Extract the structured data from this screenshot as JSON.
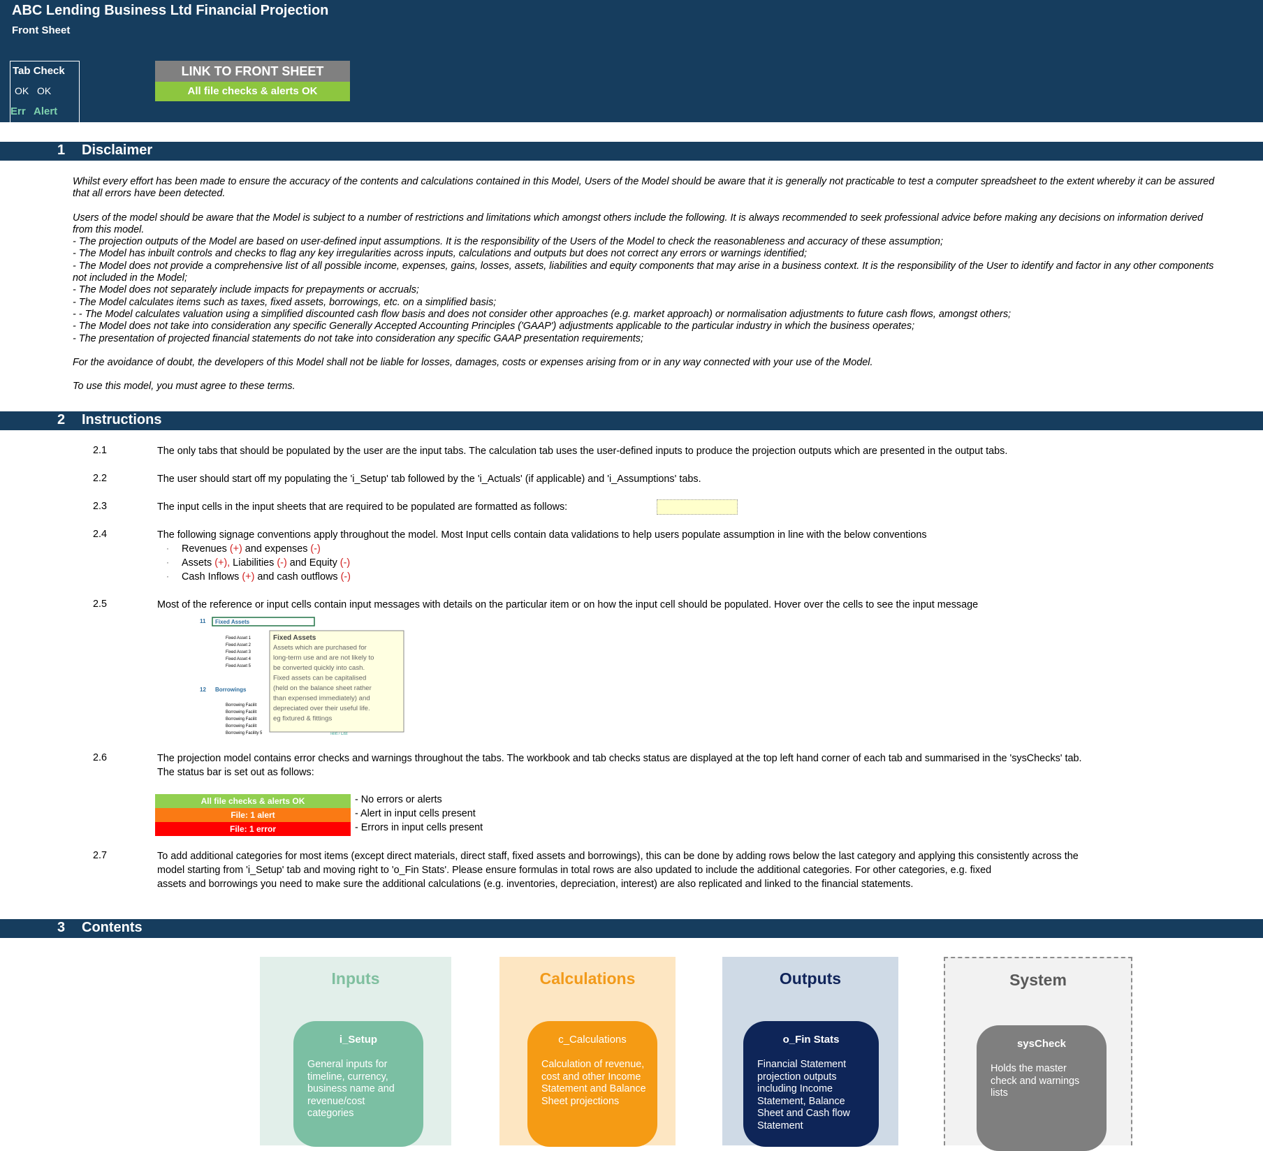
{
  "header": {
    "title": "ABC Lending Business Ltd Financial Projection",
    "sheet": "Front Sheet",
    "tab_check": {
      "title": "Tab Check",
      "ok1": "OK",
      "ok2": "OK",
      "err": "Err",
      "alert": "Alert"
    },
    "link_button": "LINK TO FRONT SHEET",
    "status": "All file checks & alerts OK"
  },
  "sections": {
    "disclaimer": {
      "num": "1",
      "title": "Disclaimer"
    },
    "instructions": {
      "num": "2",
      "title": "Instructions"
    },
    "contents": {
      "num": "3",
      "title": "Contents"
    }
  },
  "disclaimer": {
    "p1": "Whilst every effort has been made to ensure the accuracy of the contents and calculations contained in this Model, Users of the Model should be aware that it is generally not practicable to test a computer spreadsheet to the extent whereby it can be assured that all errors have been detected.",
    "p2": "Users of the model should be aware that the Model is subject to a number of restrictions and limitations which amongst others include the following. It is always recommended to seek professional advice before making any decisions on information derived from this model.",
    "items": [
      "- The projection outputs of the Model are based on user-defined input assumptions. It is the responsibility of the Users of the Model to check the reasonableness and accuracy of these assumption;",
      "- The Model has inbuilt controls and checks to flag any key irregularities across inputs, calculations and outputs but does not correct any errors or warnings identified;",
      "- The Model does not provide a comprehensive list of all possible income, expenses, gains, losses, assets, liabilities and equity components that may arise in a business context. It is the responsibility of the User to identify and factor in any other components not included in the Model;",
      "- The Model does not separately include impacts for prepayments or accruals;",
      "- The Model calculates items such as taxes, fixed assets, borrowings, etc. on a simplified basis;",
      "- - The Model calculates valuation using a simplified discounted cash flow basis and does not consider other approaches (e.g. market approach) or normalisation adjustments to future cash flows, amongst others;",
      "- The Model does not take into consideration any specific Generally Accepted Accounting Principles ('GAAP') adjustments applicable to the particular industry in which the business operates;",
      "- The presentation of projected financial statements do not take into consideration any specific GAAP presentation requirements;"
    ],
    "p3": "For the avoidance of doubt, the developers of this Model shall not be liable for losses, damages, costs or expenses arising from or in any way connected with your use of the Model.",
    "p4": "To use this model, you must agree to these terms."
  },
  "instructions": {
    "i1": {
      "num": "2.1",
      "text": "The only tabs that should be populated by the user are the input tabs. The calculation tab uses the user-defined inputs to produce the projection outputs which are presented in the output tabs."
    },
    "i2": {
      "num": "2.2",
      "text": "The user should start off my populating the 'i_Setup' tab followed by the 'i_Actuals' (if applicable) and 'i_Assumptions' tabs."
    },
    "i3": {
      "num": "2.3",
      "text": "The input cells in the input sheets that are required to be populated are formatted as follows:"
    },
    "i4": {
      "num": "2.4",
      "text": "The following signage conventions apply throughout the model. Most Input cells contain data validations to help users populate assumption in line with the below conventions",
      "b1": {
        "a": "Revenues ",
        "s1": "(+)",
        "b": " and expenses ",
        "s2": "(-)"
      },
      "b2": {
        "a": "Assets ",
        "s1": "(+),",
        "b": " Liabilities ",
        "s2": "(-)",
        "c": " and Equity ",
        "s3": "(-)"
      },
      "b3": {
        "a": "Cash Inflows ",
        "s1": "(+)",
        "b": " and cash outflows ",
        "s2": "(-)"
      }
    },
    "i5": {
      "num": "2.5",
      "text": "Most of the reference or input cells contain input messages with details on the particular item or on how the input cell should be populated. Hover over the cells to see the input message",
      "tooltip": {
        "row11": "11",
        "fixed_assets": "Fixed Assets",
        "assets": [
          "Fixed Asset 1",
          "Fixed Asset 2",
          "Fixed Asset 3",
          "Fixed Asset 4",
          "Fixed Asset 5"
        ],
        "row12": "12",
        "borrowings": "Borrowings",
        "facilities": [
          "Borrowing Facilit",
          "Borrowing Facilit",
          "Borrowing Facilit",
          "Borrowing Facilit",
          "Borrowing Facilit"
        ],
        "facility_last": "Borrowing Facility 5",
        "text_list": "Text / List",
        "box_title": "Fixed Assets",
        "box_text": "Assets which are purchased for long-term use and are not likely to be converted quickly into cash. Fixed assets can be capitalised (held on the balance sheet rather than expensed immediately) and depreciated over their useful life. eg fixtured & fittings"
      }
    },
    "i6": {
      "num": "2.6",
      "text1": "The projection model contains error checks and warnings throughout the tabs. The workbook and tab checks status are displayed at the top left hand corner of each tab and summarised in the 'sysChecks' tab.",
      "text2": "The status bar is set out as follows:",
      "legend": [
        {
          "bar": "All file checks & alerts OK",
          "desc": "- No errors or alerts",
          "color": "#92d050"
        },
        {
          "bar": "File: 1 alert",
          "desc": "- Alert in input cells present",
          "color": "#fa7a14"
        },
        {
          "bar": "File: 1 error",
          "desc": "- Errors in input cells present",
          "color": "#ff0000"
        }
      ]
    },
    "i7": {
      "num": "2.7",
      "l1": "To add additional categories for most items (except direct materials, direct staff, fixed assets and borrowings), this can be done by adding rows below the last category and applying this consistently across the",
      "l2": "model starting from 'i_Setup' tab and moving right to 'o_Fin Stats'. Please ensure formulas in total rows are also updated to include the additional categories. For other categories, e.g. fixed",
      "l3": "assets and borrowings you need to make sure the additional calculations (e.g. inventories, depreciation, interest) are also replicated and linked to the financial statements."
    }
  },
  "contents": {
    "inputs": {
      "title": "Inputs",
      "card": "i_Setup",
      "desc": "General inputs for timeline, currency, business name and revenue/cost categories",
      "title_color": "#7fbf9f",
      "bg": "#e2efea",
      "card_color": "#7bbfa3"
    },
    "calculations": {
      "title": "Calculations",
      "card": "c_Calculations",
      "desc": "Calculation of revenue, cost and other Income Statement and Balance Sheet projections",
      "title_color": "#f29a1a",
      "bg": "#fde6c2",
      "card_color": "#f59b14"
    },
    "outputs": {
      "title": "Outputs",
      "card": "o_Fin Stats",
      "desc": "Financial Statement projection outputs including Income Statement, Balance Sheet and Cash flow Statement",
      "title_color": "#10245a",
      "bg": "#cfdae6",
      "card_color": "#0e2558"
    },
    "system": {
      "title": "System",
      "card": "sysCheck",
      "desc": "Holds the master check and warnings lists",
      "title_color": "#595959",
      "bg": "#f2f2f2",
      "card_color": "#7f7f7f"
    }
  }
}
